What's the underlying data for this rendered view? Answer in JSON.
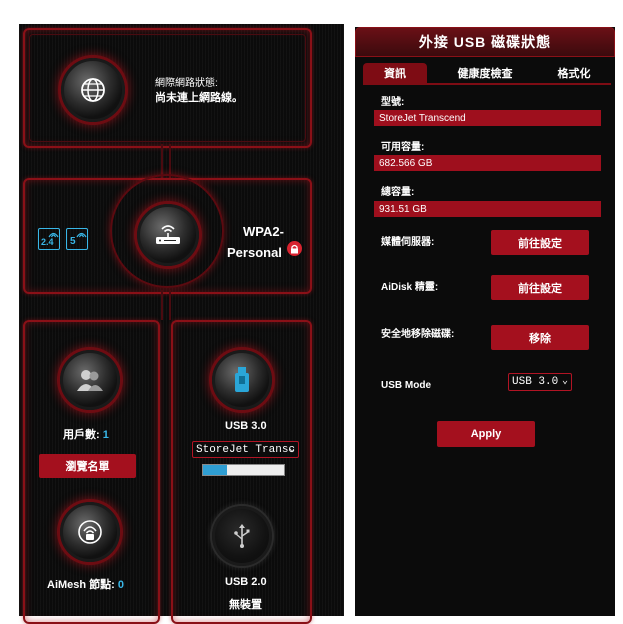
{
  "network": {
    "status_label": "網際網路狀態:",
    "status_value": "尚未連上網路線。",
    "security": "WPA2-Personal",
    "security_line1": "WPA2-",
    "security_line2": "Personal",
    "band_24": "2.4",
    "band_5": "5"
  },
  "clients": {
    "label": "用戶數:",
    "count": "1",
    "view_list_button": "瀏覽名單"
  },
  "aimesh": {
    "label": "AiMesh 節點:",
    "count": "0"
  },
  "usb30": {
    "label": "USB 3.0",
    "device_selected": "StoreJet Transc",
    "usage_fraction": 0.3
  },
  "usb20": {
    "label": "USB 2.0",
    "status": "無裝置"
  },
  "usb_panel": {
    "title": "外接 USB 磁碟狀態",
    "tabs": [
      "資訊",
      "健康度檢查",
      "格式化"
    ],
    "model_label": "型號:",
    "model_value": "StoreJet Transcend",
    "available_label": "可用容量:",
    "available_value": "682.566 GB",
    "total_label": "總容量:",
    "total_value": "931.51 GB",
    "media_server_label": "媒體伺服器:",
    "media_server_button": "前往設定",
    "aidisk_label": "AiDisk 精靈:",
    "aidisk_button": "前往設定",
    "safe_remove_label": "安全地移除磁碟:",
    "safe_remove_button": "移除",
    "usb_mode_label": "USB Mode",
    "usb_mode_value": "USB 3.0",
    "apply_button": "Apply"
  },
  "colors": {
    "accent_red": "#a4101e",
    "highlight_cyan": "#39b7e8",
    "background": "#0b0b0b"
  }
}
